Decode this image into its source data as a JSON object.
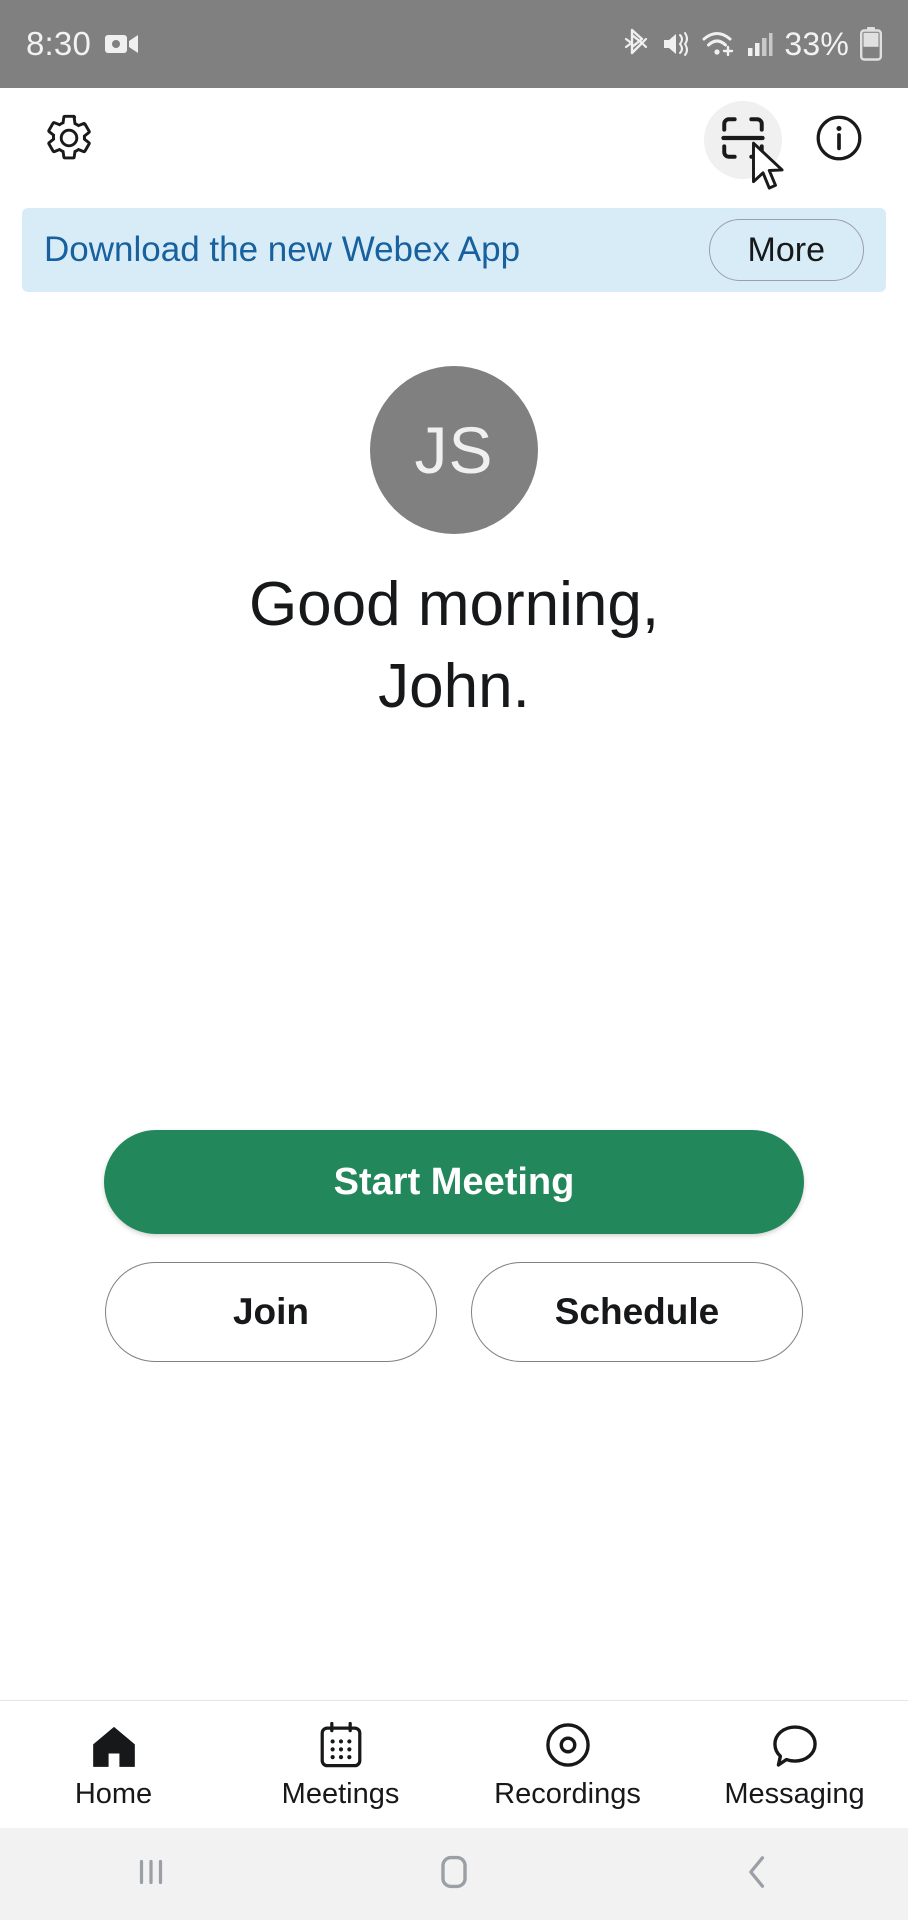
{
  "statusbar": {
    "time": "8:30",
    "battery_percent": "33%",
    "icons": [
      "video-camera-icon",
      "bluetooth-icon",
      "mute-vibrate-icon",
      "wifi-icon",
      "cellular-signal-icon",
      "battery-icon"
    ],
    "background": "#808080",
    "foreground": "#f2f2f2"
  },
  "appbar": {
    "settings_icon": "gear-icon",
    "scan_icon": "qr-scan-icon",
    "info_icon": "info-circle-icon",
    "cursor": "mouse-pointer-icon"
  },
  "banner": {
    "text": "Download the new Webex App",
    "more_label": "More",
    "background": "#d8ecf8",
    "text_color": "#17619e"
  },
  "profile": {
    "initials": "JS",
    "avatar_color": "#808080",
    "greeting_line1": "Good morning,",
    "greeting_line2": "John."
  },
  "actions": {
    "start_label": "Start Meeting",
    "start_color": "#22875a",
    "join_label": "Join",
    "schedule_label": "Schedule"
  },
  "tabs": [
    {
      "label": "Home",
      "icon": "home-icon",
      "active": true
    },
    {
      "label": "Meetings",
      "icon": "calendar-icon",
      "active": false
    },
    {
      "label": "Recordings",
      "icon": "recording-disc-icon",
      "active": false
    },
    {
      "label": "Messaging",
      "icon": "chat-bubble-icon",
      "active": false
    }
  ],
  "androidnav": {
    "recents": "recents-icon",
    "home": "home-square-icon",
    "back": "back-chevron-icon"
  }
}
